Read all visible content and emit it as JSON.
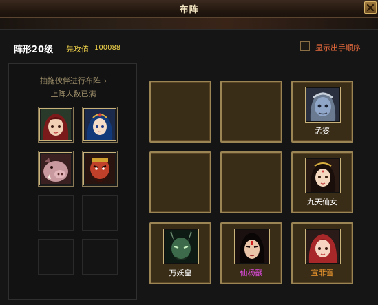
{
  "window": {
    "title": "布阵",
    "close_icon": "close-icon"
  },
  "header": {
    "formation_label": "阵形20级",
    "attack_first_label": "先攻值",
    "attack_first_value": "100088",
    "show_order_label": "显示出手顺序",
    "show_order_checked": false
  },
  "bench": {
    "hint_line1": "抽拖伙伴进行布阵→",
    "hint_line2": "上阵人数已满",
    "slots": [
      {
        "portrait": "red-hair-girl-portrait"
      },
      {
        "portrait": "blue-hair-girl-portrait"
      },
      {
        "portrait": "boar-demon-portrait"
      },
      {
        "portrait": "red-bearded-warrior-portrait"
      },
      {
        "portrait": null
      },
      {
        "portrait": null
      },
      {
        "portrait": null
      },
      {
        "portrait": null
      }
    ]
  },
  "grid": {
    "cells": [
      {
        "hero": null
      },
      {
        "hero": null
      },
      {
        "hero": {
          "name": "孟婆",
          "portrait": "blue-skin-old-woman-portrait",
          "name_color": "#ffffff"
        }
      },
      {
        "hero": null
      },
      {
        "hero": null
      },
      {
        "hero": {
          "name": "九天仙女",
          "portrait": "fairy-portrait",
          "name_color": "#ffffff"
        }
      },
      {
        "hero": {
          "name": "万妖皇",
          "portrait": "green-demon-king-portrait",
          "name_color": "#ffffff"
        }
      },
      {
        "hero": {
          "name": "仙杨戬",
          "portrait": "yang-jian-portrait",
          "name_color": "#e04ae0"
        }
      },
      {
        "hero": {
          "name": "宣菲雪",
          "portrait": "red-hair-girl-portrait",
          "name_color": "#f29a2e"
        }
      }
    ]
  },
  "colors": {
    "cell_border": "#9c8554",
    "cell_fill": "#3a2d18",
    "accent_orange": "#e86a3c",
    "accent_yellow": "#f0d24a"
  }
}
